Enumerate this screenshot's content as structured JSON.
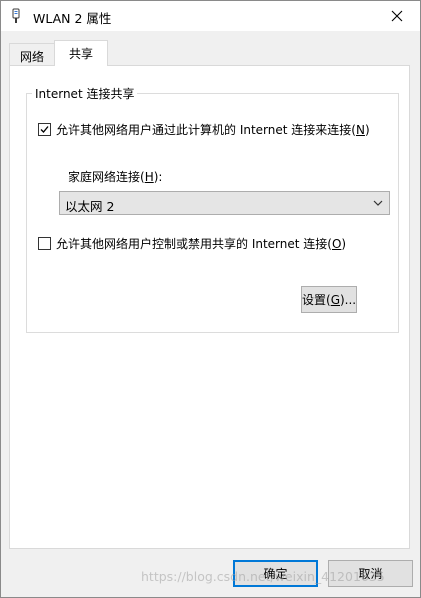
{
  "window": {
    "title": "WLAN 2 属性"
  },
  "tabs": [
    {
      "label": "网络"
    },
    {
      "label": "共享"
    }
  ],
  "group": {
    "legend": "Internet 连接共享",
    "allow_share": {
      "checked": true,
      "label": "允许其他网络用户通过此计算机的 Internet 连接来连接(",
      "mnemonic": "N",
      "label_end": ")"
    },
    "home_network": {
      "label": "家庭网络连接(",
      "mnemonic": "H",
      "label_end": "):",
      "selected": "以太网 2"
    },
    "allow_control": {
      "checked": false,
      "label": "允许其他网络用户控制或禁用共享的 Internet 连接(",
      "mnemonic": "O",
      "label_end": ")"
    },
    "settings_button": {
      "label": "设置(",
      "mnemonic": "G",
      "label_end": ")..."
    }
  },
  "footer": {
    "ok_label": "确定",
    "cancel_label": "取消"
  },
  "watermark": "https://blog.csdn.net/weixin_41201635",
  "colors": {
    "accent": "#0078d7",
    "panel": "#ffffff",
    "background": "#f0f0f0"
  },
  "icons": {
    "title": "network-adapter-icon",
    "close": "close-icon",
    "check": "check-icon",
    "dropdown": "chevron-down-icon"
  }
}
